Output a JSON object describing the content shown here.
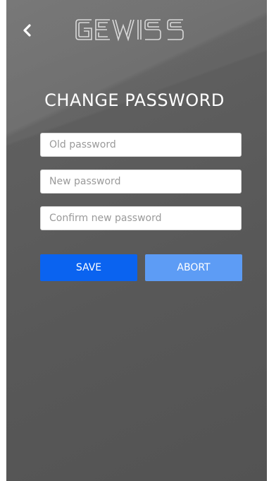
{
  "header": {
    "logo_text": "GEWISS",
    "back_icon": "chevron-left-icon"
  },
  "page": {
    "title": "CHANGE PASSWORD"
  },
  "form": {
    "old_password": {
      "placeholder": "Old password",
      "value": ""
    },
    "new_password": {
      "placeholder": "New password",
      "value": ""
    },
    "confirm_password": {
      "placeholder": "Confirm new password",
      "value": ""
    }
  },
  "actions": {
    "save_label": "SAVE",
    "abort_label": "ABORT"
  },
  "colors": {
    "background": "#5a5a5a",
    "save": "#0a63f0",
    "abort": "#5d9cf5"
  }
}
